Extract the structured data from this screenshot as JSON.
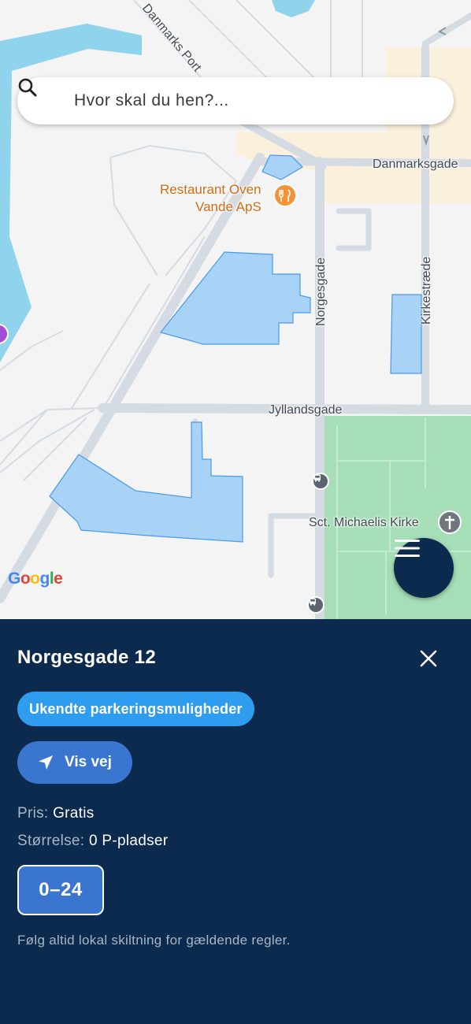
{
  "search": {
    "placeholder": "Hvor skal du hen?..."
  },
  "map": {
    "streets": {
      "danmarks_port": "Danmarks Port",
      "danmarksgade": "Danmarksgade",
      "norgesgade": "Norgesgade",
      "kirkestraede": "Kirkestræde",
      "jyllandsgade": "Jyllandsgade"
    },
    "poi": {
      "restaurant_line1": "Restaurant Oven",
      "restaurant_line2": "Vande ApS",
      "restaurant_icon": "restaurant-icon",
      "church": "Sct. Michaelis Kirke",
      "church_icon": "church-cross-icon",
      "bus_icon": "bus-stop-icon"
    },
    "attribution": {
      "letters": [
        "G",
        "o",
        "o",
        "g",
        "l",
        "e"
      ],
      "colors": [
        "#4285F4",
        "#EA4335",
        "#FBBC05",
        "#4285F4",
        "#34A853",
        "#EA4335"
      ]
    },
    "colors": {
      "water": "#8fd3ec",
      "park": "#a6dfb7",
      "parking_fill": "#a9d2f7",
      "parking_stroke": "#4a9ae6",
      "commercial": "#fbf0dc",
      "road": "#d5dbe2"
    }
  },
  "menu": {
    "icon": "hamburger-menu-icon"
  },
  "panel": {
    "title": "Norgesgade 12",
    "close_icon": "close-icon",
    "badge": "Ukendte parkeringsmuligheder",
    "directions_label": "Vis vej",
    "directions_icon": "navigation-arrow-icon",
    "price_key": "Pris:",
    "price_value": "Gratis",
    "size_key": "Størrelse:",
    "size_value": "0 P-pladser",
    "hours": "0–24",
    "disclaimer": "Følg altid lokal skiltning for gældende regler."
  },
  "colors": {
    "panel_bg": "#0c2a4d",
    "badge_bg": "#2e9df0",
    "button_bg": "#3a76cf"
  }
}
